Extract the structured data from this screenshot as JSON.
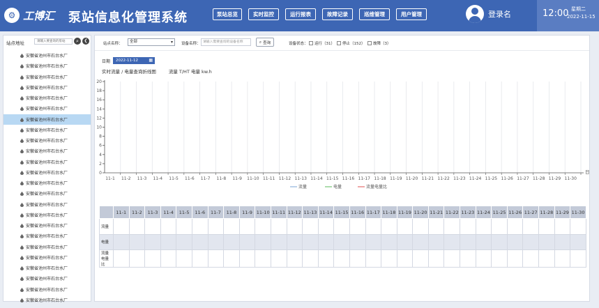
{
  "header": {
    "brand": "工博汇",
    "title": "泵站信息化管理系统",
    "nav": [
      "泵站总览",
      "实时监控",
      "运行报表",
      "故障记录",
      "巡维管理",
      "用户管理"
    ],
    "login_label": "登录名",
    "time": "12:00",
    "weekday": "星期二",
    "date": "2022-11-15",
    "colors": {
      "header_bg": "#3d66b4",
      "clock_panel_bg": "#5a7dc2"
    }
  },
  "sidebar": {
    "site_label": "站点地址",
    "search_placeholder": "请输入要查询的泵站",
    "search_icon": "search-icon",
    "back_icon": "back-arrow-icon",
    "item_icon": "water-drop-icon",
    "items": [
      "安徽省池州市石台水厂",
      "安徽省池州市石台水厂",
      "安徽省池州市石台水厂",
      "安徽省池州市石台水厂",
      "安徽省池州市石台水厂",
      "安徽省池州市石台水厂",
      "安徽省池州市石台水厂",
      "安徽省池州市石台水厂",
      "安徽省池州市石台水厂",
      "安徽省池州市石台水厂",
      "安徽省池州市石台水厂",
      "安徽省池州市石台水厂",
      "安徽省池州市石台水厂",
      "安徽省池州市石台水厂",
      "安徽省池州市石台水厂",
      "安徽省池州市石台水厂",
      "安徽省池州市石台水厂",
      "安徽省池州市石台水厂",
      "安徽省池州市石台水厂",
      "安徽省池州市石台水厂",
      "安徽省池州市石台水厂",
      "安徽省池州市石台水厂",
      "安徽省池州市石台水厂",
      "安徽省池州市石台水厂"
    ],
    "selected_index": 6,
    "selected_color": "#b8d8f3"
  },
  "filters": {
    "station_label": "站点名称：",
    "station_value": "全部",
    "device_label": "设备名称：",
    "device_placeholder": "请输入需要查询的设备名称",
    "query_button": "查询",
    "status_label": "设备状态：",
    "statuses": [
      "运行（31）",
      "停止（152）",
      "故障（3）"
    ]
  },
  "date_row": {
    "label": "日期",
    "value": "2022-11-12"
  },
  "caption": {
    "left": "实时流量 / 电量查询折线图",
    "right": "流量 T/HT  电量 kw.h"
  },
  "chart_data": {
    "type": "line",
    "x": [
      "11-1",
      "11-2",
      "11-3",
      "11-4",
      "11-5",
      "11-6",
      "11-7",
      "11-8",
      "11-9",
      "11-10",
      "11-11",
      "11-12",
      "11-13",
      "11-14",
      "11-15",
      "11-16",
      "11-17",
      "11-18",
      "11-19",
      "11-20",
      "11-21",
      "11-22",
      "11-23",
      "11-24",
      "11-25",
      "11-26",
      "11-27",
      "11-28",
      "11-29",
      "11-30"
    ],
    "x_axis_name": "日期",
    "ylim": [
      0,
      20
    ],
    "yticks": [
      0,
      2,
      4,
      6,
      8,
      10,
      12,
      14,
      16,
      18,
      20
    ],
    "grid": "vertical",
    "legend_position": "bottom-center",
    "series": [
      {
        "name": "流量",
        "color": "#7aa6d6",
        "values": []
      },
      {
        "name": "电量",
        "color": "#5bb85b",
        "values": []
      },
      {
        "name": "流量电量比",
        "color": "#e05050",
        "values": []
      }
    ]
  },
  "table": {
    "columns": [
      "11-1",
      "11-2",
      "11-3",
      "11-4",
      "11-5",
      "11-6",
      "11-7",
      "11-8",
      "11-9",
      "11-10",
      "11-11",
      "11-12",
      "11-13",
      "11-14",
      "11-15",
      "11-16",
      "11-17",
      "11-18",
      "11-19",
      "11-20",
      "11-21",
      "11-22",
      "11-23",
      "11-24",
      "11-25",
      "11-26",
      "11-27",
      "11-28",
      "11-29",
      "11-30"
    ],
    "rows": [
      {
        "label": "流量"
      },
      {
        "label": "电量"
      },
      {
        "label": "流量电量比"
      }
    ]
  }
}
